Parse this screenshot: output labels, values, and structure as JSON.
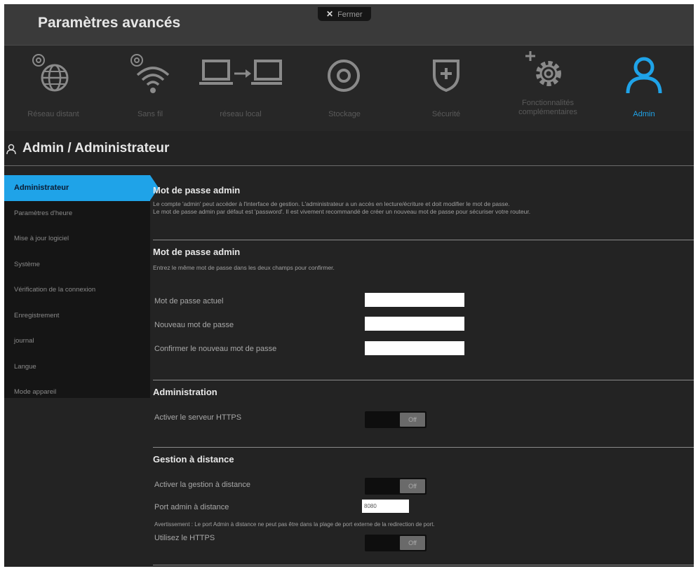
{
  "header": {
    "title": "Paramètres avancés",
    "close_label": "Fermer"
  },
  "nav": {
    "items": [
      {
        "label": "Réseau distant",
        "icon": "globe-gear-icon"
      },
      {
        "label": "Sans fil",
        "icon": "wifi-gear-icon"
      },
      {
        "label": "réseau local",
        "icon": "lan-computers-icon"
      },
      {
        "label": "Stockage",
        "icon": "storage-disk-icon"
      },
      {
        "label": "Sécurité",
        "icon": "shield-plus-icon"
      },
      {
        "label": "Fonctionnalités complémentaires",
        "icon": "gear-plus-icon"
      },
      {
        "label": "Admin",
        "icon": "user-icon"
      }
    ],
    "active_color": "#1fa3e8",
    "inactive_color": "#5a5a5a"
  },
  "page": {
    "title": "Admin / Administrateur"
  },
  "sidebar": {
    "items": [
      {
        "label": "Administrateur"
      },
      {
        "label": "Paramètres d'heure"
      },
      {
        "label": "Mise à jour logiciel"
      },
      {
        "label": "Système"
      },
      {
        "label": "Vérification de la connexion"
      },
      {
        "label": "Enregistrement"
      },
      {
        "label": "journal"
      },
      {
        "label": "Langue"
      },
      {
        "label": "Mode appareil"
      }
    ]
  },
  "main": {
    "intro": {
      "title": "Mot de passe admin",
      "line1": "Le compte 'admin' peut accéder à l'interface de gestion. L'administrateur a un accès en lecture/écriture et doit modifier le mot de passe.",
      "line2": "Le mot de passe admin par défaut est 'password'. Il est vivement recommandé de créer un nouveau mot de passe pour sécuriser votre routeur."
    },
    "password": {
      "title": "Mot de passe admin",
      "desc": "Entrez le même mot de passe dans les deux champs pour confirmer.",
      "current_label": "Mot de passe actuel",
      "new_label": "Nouveau mot de passe",
      "confirm_label": "Confirmer le nouveau mot de passe"
    },
    "administration": {
      "title": "Administration",
      "https_label": "Activer le serveur HTTPS",
      "https_state": "Off"
    },
    "remote": {
      "title": "Gestion à distance",
      "enable_label": "Activer la gestion à distance",
      "enable_state": "Off",
      "port_label": "Port admin à distance",
      "port_value": "8080",
      "warning": "Avertissement : Le port Admin à distance ne peut pas être dans la plage de port externe de la redirection de port.",
      "https_label": "Utilisez le HTTPS",
      "https_state": "Off"
    }
  }
}
